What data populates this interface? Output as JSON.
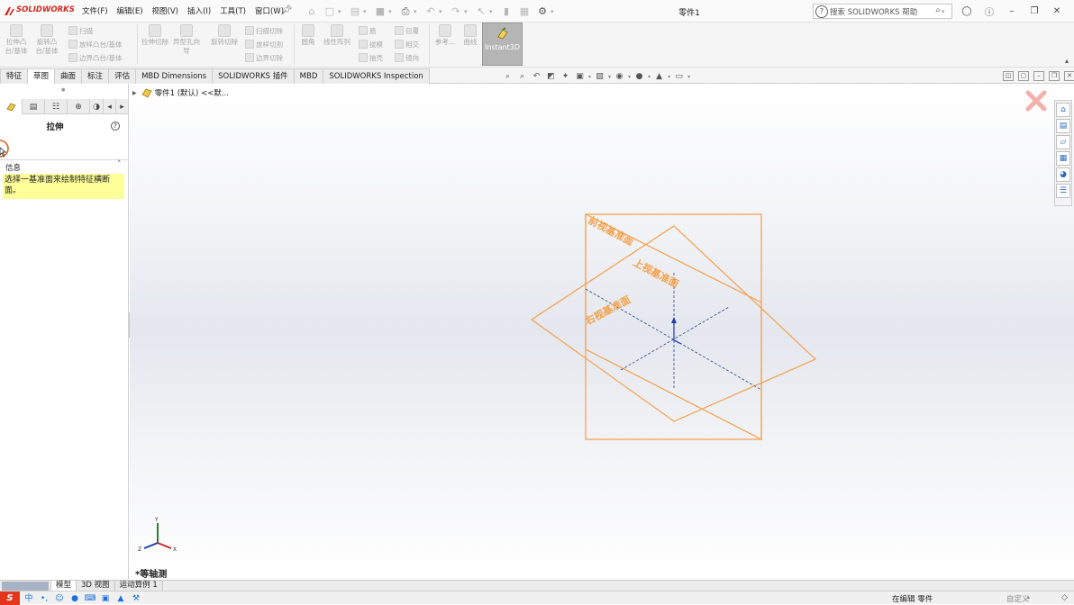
{
  "app": {
    "logo_text": "SOLIDWORKS",
    "doc_title": "零件1"
  },
  "menu": [
    "文件(F)",
    "编辑(E)",
    "视图(V)",
    "插入(I)",
    "工具(T)",
    "窗口(W)"
  ],
  "search": {
    "placeholder": "搜索 SOLIDWORKS 帮助"
  },
  "command_manager": {
    "large_buttons": [
      {
        "label": "拉伸凸台/基体",
        "icon": "extrude-boss-icon"
      },
      {
        "label": "旋转凸台/基体",
        "icon": "revolve-boss-icon"
      },
      {
        "label": "拉伸切除",
        "icon": "extrude-cut-icon"
      },
      {
        "label": "异型孔向导",
        "icon": "hole-wizard-icon"
      },
      {
        "label": "旋转切除",
        "icon": "revolve-cut-icon"
      },
      {
        "label": "圆角",
        "icon": "fillet-icon"
      },
      {
        "label": "线性阵列",
        "icon": "linear-pattern-icon"
      },
      {
        "label": "参考...",
        "icon": "reference-geometry-icon"
      },
      {
        "label": "曲线",
        "icon": "curves-icon"
      }
    ],
    "small_buttons": [
      {
        "label": "扫描",
        "icon": "sweep-icon"
      },
      {
        "label": "放样凸台/基体",
        "icon": "loft-icon"
      },
      {
        "label": "边界凸台/基体",
        "icon": "boundary-boss-icon"
      },
      {
        "label": "扫描切除",
        "icon": "swept-cut-icon"
      },
      {
        "label": "放样切割",
        "icon": "lofted-cut-icon"
      },
      {
        "label": "边界切除",
        "icon": "boundary-cut-icon"
      },
      {
        "label": "筋",
        "icon": "rib-icon"
      },
      {
        "label": "拔模",
        "icon": "draft-icon"
      },
      {
        "label": "抽壳",
        "icon": "shell-icon"
      },
      {
        "label": "包覆",
        "icon": "wrap-icon"
      },
      {
        "label": "相交",
        "icon": "intersect-icon"
      },
      {
        "label": "镜向",
        "icon": "mirror-icon"
      }
    ],
    "instant3d_label": "Instant3D"
  },
  "cm_tabs": [
    "特征",
    "草图",
    "曲面",
    "标注",
    "评估",
    "MBD Dimensions",
    "SOLIDWORKS 插件",
    "MBD",
    "SOLIDWORKS Inspection"
  ],
  "left_panel": {
    "title": "拉伸",
    "info_label": "信息",
    "info_message": "选择一基准面来绘制特征横断面。"
  },
  "tree": {
    "root_label": "零件1 (默认) <<默..."
  },
  "viewport": {
    "planes": [
      "前视基准面",
      "上视基准面",
      "右视基准面"
    ],
    "view_name": "*等轴测",
    "triad_axes": [
      "Y",
      "X",
      "Z"
    ]
  },
  "model_tabs": [
    "模型",
    "3D 视图",
    "运动算例 1"
  ],
  "status": {
    "mode": "在编辑 零件",
    "custom": "自定义"
  },
  "colors": {
    "plane": "#f4a04a",
    "brand_red": "#d12b1f",
    "instant3d_bg": "#b5b5b5",
    "info_bg": "#ffff99"
  }
}
